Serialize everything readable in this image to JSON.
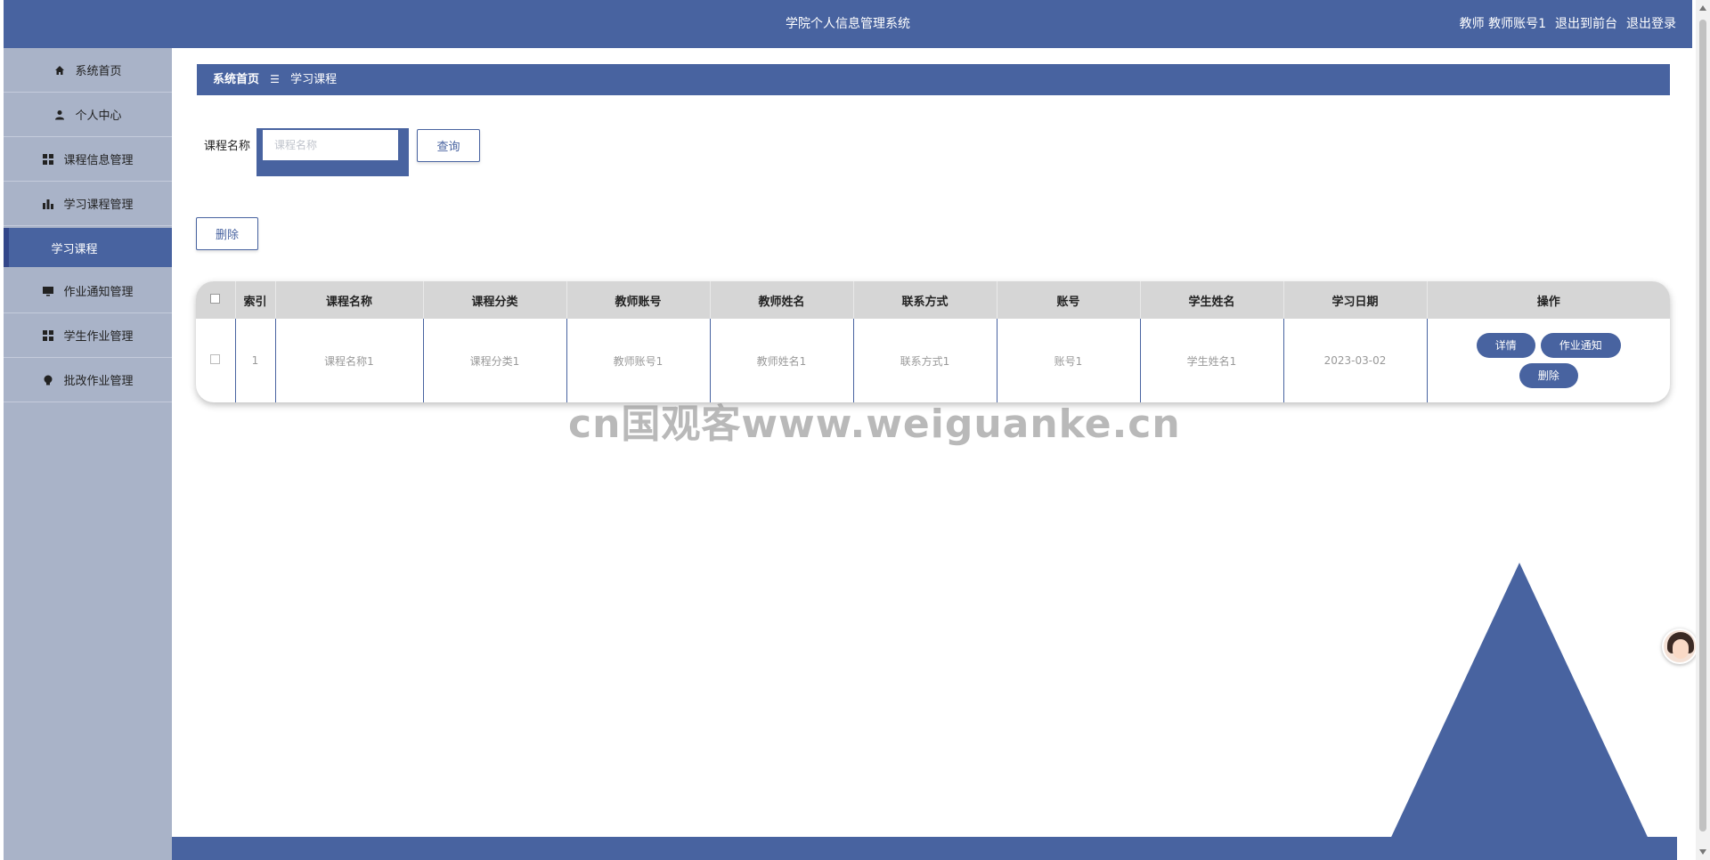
{
  "header": {
    "title": "学院个人信息管理系统",
    "user": "教师 教师账号1",
    "exit_front": "退出到前台",
    "logout": "退出登录"
  },
  "sidebar": {
    "items": [
      {
        "label": "系统首页",
        "icon": "home-icon"
      },
      {
        "label": "个人中心",
        "icon": "user-icon"
      },
      {
        "label": "课程信息管理",
        "icon": "grid-icon"
      },
      {
        "label": "学习课程管理",
        "icon": "bar-chart-icon"
      },
      {
        "label": "学习课程",
        "icon": "",
        "sub": true
      },
      {
        "label": "作业通知管理",
        "icon": "monitor-icon"
      },
      {
        "label": "学生作业管理",
        "icon": "grid-icon"
      },
      {
        "label": "批改作业管理",
        "icon": "bulb-icon"
      }
    ]
  },
  "breadcrumb": {
    "home": "系统首页",
    "separator": "☰",
    "current": "学习课程"
  },
  "search": {
    "label": "课程名称",
    "placeholder": "课程名称",
    "value": "",
    "query_button": "查询"
  },
  "actions": {
    "delete_button": "删除"
  },
  "table": {
    "columns": [
      "",
      "索引",
      "课程名称",
      "课程分类",
      "教师账号",
      "教师姓名",
      "联系方式",
      "账号",
      "学生姓名",
      "学习日期",
      "操作"
    ],
    "rows": [
      {
        "index": "1",
        "course_name": "课程名称1",
        "course_category": "课程分类1",
        "teacher_account": "教师账号1",
        "teacher_name": "教师姓名1",
        "contact": "联系方式1",
        "account": "账号1",
        "student_name": "学生姓名1",
        "study_date": "2023-03-02",
        "ops": {
          "detail": "详情",
          "notice": "作业通知",
          "delete": "删除"
        }
      }
    ]
  },
  "watermark": "cn国观客www.weiguanke.cn",
  "colors": {
    "primary": "#4863a0",
    "sidebar_bg": "#a9b3c8",
    "table_header_bg": "#d6d6d6"
  }
}
